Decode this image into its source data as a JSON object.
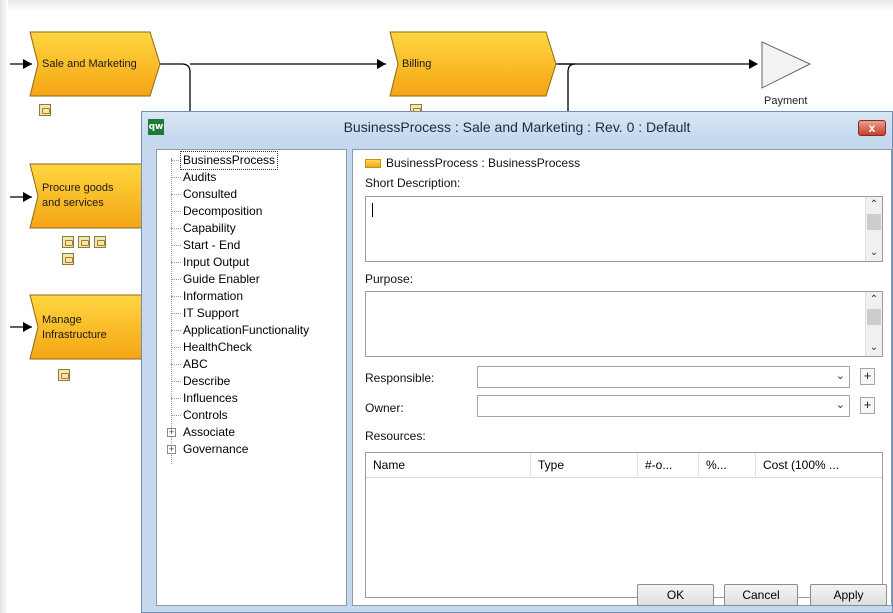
{
  "diagram": {
    "processes": [
      {
        "label_lines": [
          "Sale and Marketing"
        ]
      },
      {
        "label_lines": [
          "Billing"
        ]
      },
      {
        "label_lines": [
          "Procure goods",
          "and services"
        ]
      },
      {
        "label_lines": [
          "Manage",
          "Infrastructure"
        ]
      }
    ],
    "payment_label": "Payment",
    "colors": {
      "process_fill_top": "#ffd640",
      "process_fill_bottom": "#f5a514",
      "process_border": "#8a6a1a"
    }
  },
  "dialog": {
    "app_icon": "qw",
    "title": "BusinessProcess : Sale and Marketing : Rev. 0  : Default",
    "close_label": "x",
    "tree": {
      "items": [
        {
          "label": "BusinessProcess",
          "selected": true
        },
        {
          "label": "Audits"
        },
        {
          "label": "Consulted"
        },
        {
          "label": "Decomposition"
        },
        {
          "label": "Capability"
        },
        {
          "label": "Start - End"
        },
        {
          "label": "Input Output"
        },
        {
          "label": "Guide Enabler"
        },
        {
          "label": "Information"
        },
        {
          "label": "IT Support"
        },
        {
          "label": "ApplicationFunctionality"
        },
        {
          "label": "HealthCheck"
        },
        {
          "label": "ABC"
        },
        {
          "label": "Describe"
        },
        {
          "label": "Influences"
        },
        {
          "label": "Controls"
        },
        {
          "label": "Associate",
          "expandable": true
        },
        {
          "label": "Governance",
          "expandable": true
        }
      ]
    },
    "panel": {
      "header": "BusinessProcess : BusinessProcess",
      "short_description_label": "Short Description:",
      "purpose_label": "Purpose:",
      "responsible_label": "Responsible:",
      "owner_label": "Owner:",
      "resources_label": "Resources:",
      "plus": "+",
      "resources_columns": [
        "Name",
        "Type",
        "#-o...",
        "%...",
        "Cost (100% ..."
      ]
    },
    "buttons": {
      "ok": "OK",
      "cancel": "Cancel",
      "apply": "Apply"
    }
  }
}
